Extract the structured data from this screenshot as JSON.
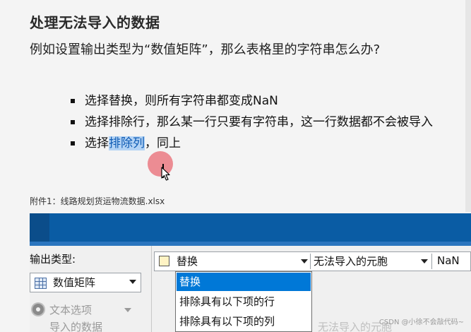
{
  "slide": {
    "title": "处理无法导入的数据",
    "intro": "例如设置输出类型为“数值矩阵”，那么表格里的字符串怎么办?",
    "bullets": [
      {
        "text": "选择替换，则所有字符串都变成NaN"
      },
      {
        "text": "选择排除行，那么某一行只要有字符串，这一行数据都不会被导入"
      },
      {
        "before": "选择",
        "highlight": "排除列",
        "after": "，同上"
      }
    ]
  },
  "caption": "附件1：线路规划货运物流数据.xlsx",
  "app": {
    "output_type_label": "输出类型:",
    "output_type_value": "数值矩阵",
    "text_options_label": "文本选项",
    "import_data_label": "导入的数据",
    "rule": {
      "action_value": "替换",
      "cell_type_value": "无法导入的元胞",
      "replacement_value": "NaN"
    },
    "dropdown_options": [
      "替换",
      "排除具有以下项的行",
      "排除具有以下项的列"
    ],
    "dropdown_selected_index": 0,
    "faded_background_text": "无法导入的元胞"
  },
  "watermark": "CSDN @小徐不会敲代码~",
  "colors": {
    "ribbon": "#0a5ca4",
    "selection": "#0078d7",
    "text_highlight": "#b3d3f5",
    "cursor_ring": "#e85460"
  }
}
